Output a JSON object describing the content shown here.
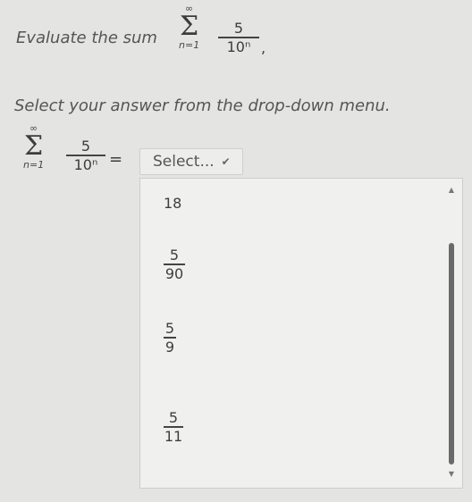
{
  "question": {
    "prefix": "Evaluate the sum",
    "upper": "∞",
    "lower": "n=1",
    "numerator": "5",
    "denominator": "10ⁿ",
    "suffix": ","
  },
  "instruction": "Select your answer from the drop-down menu.",
  "answer_row": {
    "upper": "∞",
    "lower": "n=1",
    "numerator": "5",
    "denominator": "10ⁿ",
    "equals": "="
  },
  "select": {
    "value": "Select...",
    "chevron_icon": "chevron-down-icon"
  },
  "dropdown": {
    "options": [
      {
        "type": "text",
        "label": "18"
      },
      {
        "type": "fraction",
        "numerator": "5",
        "denominator": "90"
      },
      {
        "type": "fraction",
        "numerator": "5",
        "denominator": "9"
      },
      {
        "type": "fraction",
        "numerator": "5",
        "denominator": "11"
      }
    ],
    "scroll_up_icon": "scroll-up-arrow-icon",
    "scroll_down_icon": "scroll-down-arrow-icon"
  }
}
